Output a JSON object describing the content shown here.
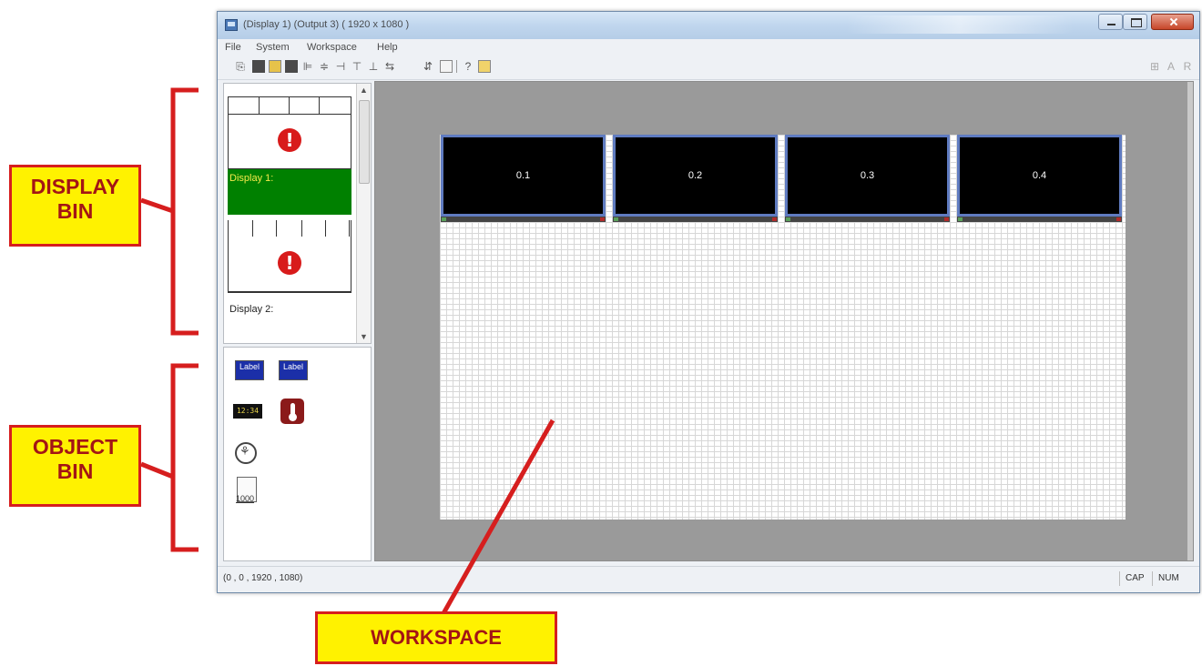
{
  "window": {
    "title": "(Display 1) (Output 3) ( 1920 x 1080 )"
  },
  "menu": {
    "file": "File",
    "system": "System",
    "workspace": "Workspace",
    "help": "Help"
  },
  "display_bin": {
    "items": [
      {
        "label": "Display 1:"
      },
      {
        "label": "Display 2:"
      }
    ],
    "alert_glyph": "!",
    "scroll_up": "▲",
    "scroll_down": "▼"
  },
  "object_bin": {
    "label_obj_text": "Label",
    "clock_text": "12:34",
    "doc_number": "1000"
  },
  "workspace": {
    "screens": [
      {
        "label": "0.1"
      },
      {
        "label": "0.2"
      },
      {
        "label": "0.3"
      },
      {
        "label": "0.4"
      }
    ]
  },
  "status": {
    "coords": "(0 , 0 , 1920 , 1080)",
    "caps": "CAP",
    "num": "NUM"
  },
  "annotations": {
    "display_bin_line1": "DISPLAY",
    "display_bin_line2": "BIN",
    "object_bin_line1": "OBJECT",
    "object_bin_line2": "BIN",
    "workspace": "WORKSPACE",
    "color": "#d61e1e"
  }
}
